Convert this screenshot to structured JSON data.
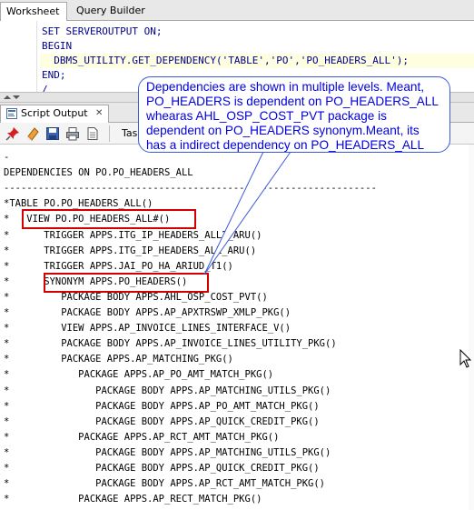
{
  "tabs": [
    {
      "label": "Worksheet",
      "active": true
    },
    {
      "label": "Query Builder",
      "active": false
    }
  ],
  "editor": {
    "lines": [
      "SET SERVEROUTPUT ON;",
      "BEGIN",
      "  DBMS_UTILITY.GET_DEPENDENCY('TABLE','PO','PO_HEADERS_ALL');",
      "END;",
      "/"
    ]
  },
  "output_panel": {
    "tab_label": "Script Output",
    "toolbar_label": "Task"
  },
  "output_lines": [
    "-",
    "DEPENDENCIES ON PO.PO_HEADERS_ALL",
    "-----------------------------------------------------------------",
    "*TABLE PO.PO_HEADERS_ALL()",
    "*   VIEW PO.PO_HEADERS_ALL#()",
    "*      TRIGGER APPS.ITG_IP_HEADERS_ALL2_ARU()",
    "*      TRIGGER APPS.ITG_IP_HEADERS_ALL_ARU()",
    "*      TRIGGER APPS.JAI_PO_HA_ARIUD_T1()",
    "*      SYNONYM APPS.PO_HEADERS()",
    "*         PACKAGE BODY APPS.AHL_OSP_COST_PVT()",
    "*         PACKAGE BODY APPS.AP_APXTRSWP_XMLP_PKG()",
    "*         VIEW APPS.AP_INVOICE_LINES_INTERFACE_V()",
    "*         PACKAGE BODY APPS.AP_INVOICE_LINES_UTILITY_PKG()",
    "*         PACKAGE APPS.AP_MATCHING_PKG()",
    "*            PACKAGE APPS.AP_PO_AMT_MATCH_PKG()",
    "*               PACKAGE BODY APPS.AP_MATCHING_UTILS_PKG()",
    "*               PACKAGE BODY APPS.AP_PO_AMT_MATCH_PKG()",
    "*               PACKAGE BODY APPS.AP_QUICK_CREDIT_PKG()",
    "*            PACKAGE APPS.AP_RCT_AMT_MATCH_PKG()",
    "*               PACKAGE BODY APPS.AP_MATCHING_UTILS_PKG()",
    "*               PACKAGE BODY APPS.AP_QUICK_CREDIT_PKG()",
    "*               PACKAGE BODY APPS.AP_RCT_AMT_MATCH_PKG()",
    "*            PACKAGE APPS.AP_RECT_MATCH_PKG()"
  ],
  "callout": {
    "text": "Dependencies are shown in multiple levels. Meant, PO_HEADERS is dependent on PO_HEADERS_ALL whearas AHL_OSP_COST_PVT package is dependent on PO_HEADERS synonym.Meant, its has a indirect dependency on PO_HEADERS_ALL"
  },
  "colors": {
    "code_text": "#00008b",
    "callout_text": "#0000dd",
    "callout_border": "#3b5bdb",
    "highlight_box": "#d40000"
  }
}
